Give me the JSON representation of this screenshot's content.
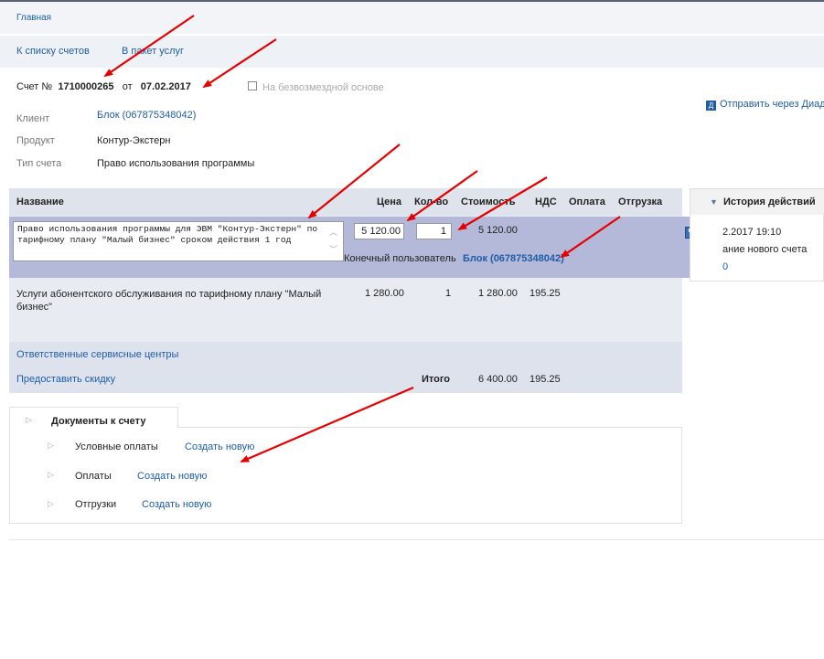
{
  "breadcrumb": {
    "home": "Главная"
  },
  "subnav": {
    "to_invoices": "К списку счетов",
    "to_package": "В пакет услуг"
  },
  "invoice": {
    "number_label": "Счет №",
    "number": "1710000265",
    "date_sep": "от",
    "date": "07.02.2017",
    "free_label": "На безвозмездной основе"
  },
  "send_diadoc": "Отправить через Диад",
  "fields": {
    "client_label": "Клиент",
    "client_value": "Блок (067875348042)",
    "product_label": "Продукт",
    "product_value": "Контур-Экстерн",
    "type_label": "Тип счета",
    "type_value": "Право использования программы"
  },
  "table": {
    "headers": [
      "Название",
      "Цена",
      "Кол-во",
      "Стоимость",
      "НДС",
      "Оплата",
      "Отгрузка"
    ],
    "edit_row": {
      "name": "Право использования программы для ЭВМ \"Контур-Экстерн\" по тарифному плану \"Малый бизнес\" сроком действия 1 год",
      "price": "5 120.00",
      "qty": "1",
      "cost": "5 120.00",
      "end_user_label": "Конечный пользователь",
      "end_user_value": "Блок (067875348042)"
    },
    "row2": {
      "name": "Услуги абонентского обслуживания по тарифному плану \"Малый бизнес\"",
      "price": "1 280.00",
      "qty": "1",
      "cost": "1 280.00",
      "vat": "195.25"
    },
    "service_centers": "Ответственные сервисные центры",
    "discount": "Предоставить скидку",
    "total_label": "Итого",
    "total_cost": "6 400.00",
    "total_vat": "195.25"
  },
  "history": {
    "title": "История действий",
    "date": "2.2017 19:10",
    "event": "ание нового счета",
    "value": "0"
  },
  "docs": {
    "tab": "Документы к счету",
    "items": [
      {
        "label": "Условные оплаты",
        "action": "Создать новую"
      },
      {
        "label": "Оплаты",
        "action": "Создать новую"
      },
      {
        "label": "Отгрузки",
        "action": "Создать новую"
      }
    ]
  },
  "colors": {
    "link": "#1f5da6",
    "highlight_row": "#b4b8d9",
    "annotation_arrow": "#e60000"
  }
}
